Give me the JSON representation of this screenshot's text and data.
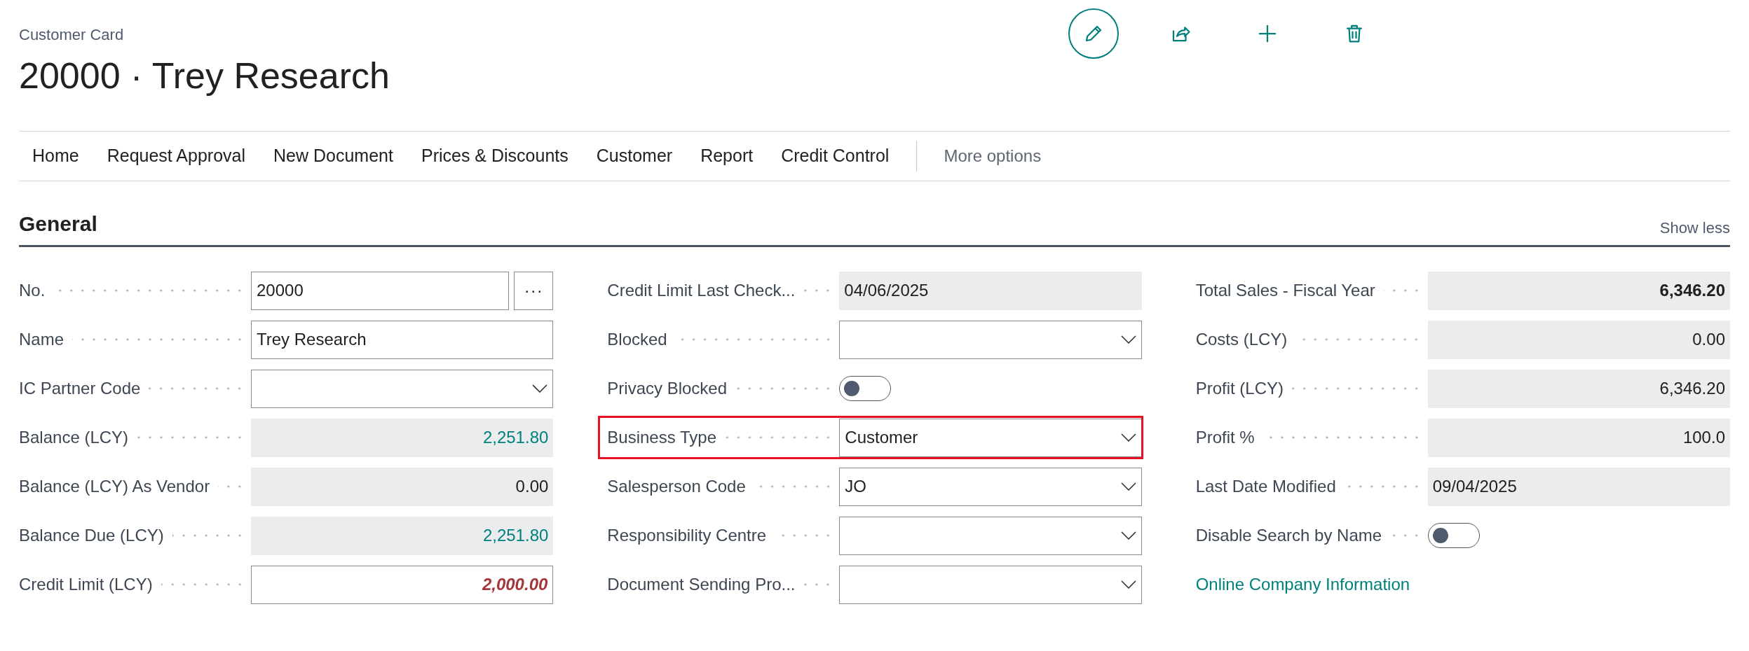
{
  "page": {
    "caption": "Customer Card",
    "title": "20000 · Trey Research"
  },
  "actions": [
    {
      "kind": "edit",
      "circled": true
    },
    {
      "kind": "share",
      "circled": false
    },
    {
      "kind": "new",
      "circled": false
    },
    {
      "kind": "delete",
      "circled": false
    }
  ],
  "menu": {
    "items": [
      "Home",
      "Request Approval",
      "New Document",
      "Prices & Discounts",
      "Customer",
      "Report",
      "Credit Control"
    ],
    "more_options": "More options"
  },
  "section": {
    "title": "General",
    "toggle": "Show less"
  },
  "columns": [
    [
      {
        "label": "No.",
        "kind": "lookup",
        "value": "20000",
        "button": "···"
      },
      {
        "label": "Name",
        "kind": "text",
        "value": "Trey Research"
      },
      {
        "label": "IC Partner Code",
        "kind": "dropdown"
      },
      {
        "label": "Balance (LCY)",
        "kind": "drilldown",
        "value": "2,251.80"
      },
      {
        "label": "Balance (LCY) As Vendor",
        "kind": "amount",
        "value": "0.00"
      },
      {
        "label": "Balance Due (LCY)",
        "kind": "drilldown",
        "value": "2,251.80"
      },
      {
        "label": "Credit Limit (LCY)",
        "kind": "limit",
        "value": "2,000.00"
      }
    ],
    [
      {
        "label": "Credit Limit Last Check...",
        "kind": "date",
        "value": "04/06/2025"
      },
      {
        "label": "Blocked",
        "kind": "dropdown"
      },
      {
        "label": "Privacy Blocked",
        "kind": "toggle",
        "on": false
      },
      {
        "label": "Business Type",
        "kind": "dropdown",
        "value": "Customer",
        "highlighted": true
      },
      {
        "label": "Salesperson Code",
        "kind": "dropdown",
        "value": "JO"
      },
      {
        "label": "Responsibility Centre",
        "kind": "dropdown"
      },
      {
        "label": "Document Sending Pro...",
        "kind": "dropdown"
      }
    ],
    [
      {
        "label": "Total Sales - Fiscal Year",
        "kind": "total",
        "value": "6,346.20"
      },
      {
        "label": "Costs (LCY)",
        "kind": "amount",
        "value": "0.00"
      },
      {
        "label": "Profit (LCY)",
        "kind": "amount",
        "value": "6,346.20"
      },
      {
        "label": "Profit %",
        "kind": "amount",
        "value": "100.0"
      },
      {
        "label": "Last Date Modified",
        "kind": "date",
        "value": "09/04/2025"
      },
      {
        "label": "Disable Search by Name",
        "kind": "toggle",
        "on": false
      },
      {
        "label": "Online Company Information",
        "kind": "link"
      }
    ]
  ]
}
